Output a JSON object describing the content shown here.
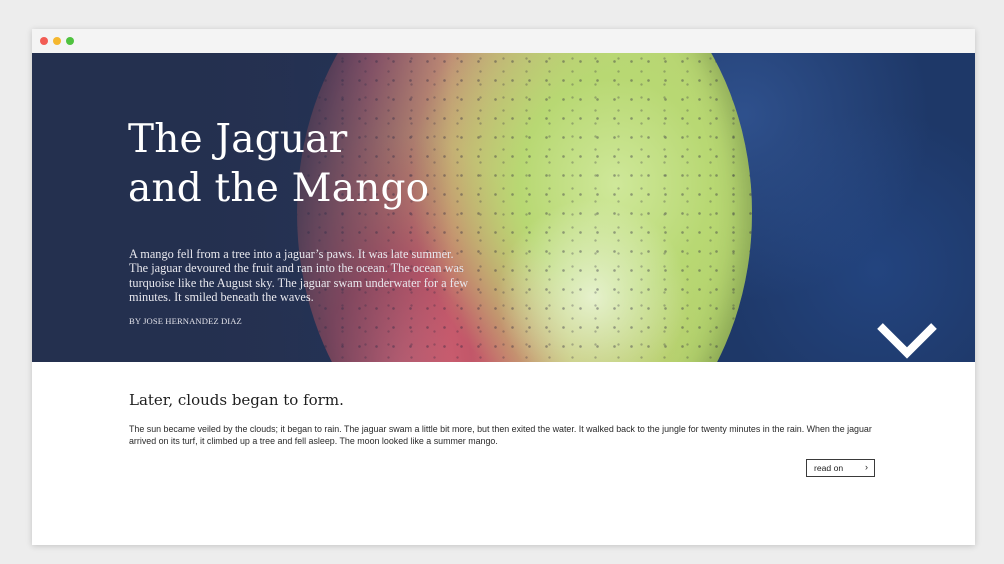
{
  "window": {
    "controls": [
      "close",
      "minimize",
      "maximize"
    ]
  },
  "hero": {
    "title_line1": "The Jaguar",
    "title_line2": "and the Mango",
    "description": "A mango fell from a tree into a jaguar’s paws. It was late summer. The jaguar devoured the fruit and ran into the ocean. The ocean was turquoise like the August sky. The jaguar swam underwater for a few minutes. It smiled beneath the waves.",
    "byline": "BY JOSE HERNANDEZ DIAZ",
    "scroll_icon": "chevron-down-icon"
  },
  "article": {
    "heading": "Later, clouds began to form.",
    "body": "The sun became veiled by the clouds; it began to rain. The jaguar swam a little bit more, but then exited the water. It walked back to the jungle for twenty minutes in the rain. When the jaguar arrived on its turf, it climbed up a tree and fell asleep. The moon looked like a summer mango.",
    "read_on_label": "read on",
    "read_on_arrow": "›"
  },
  "colors": {
    "hero_dark": "#24304f",
    "hero_blue": "#1e3868",
    "mango_green": "#b8d873",
    "mango_red": "#c25769",
    "text_light": "#ffffff",
    "text_dark": "#1e1e1e"
  }
}
